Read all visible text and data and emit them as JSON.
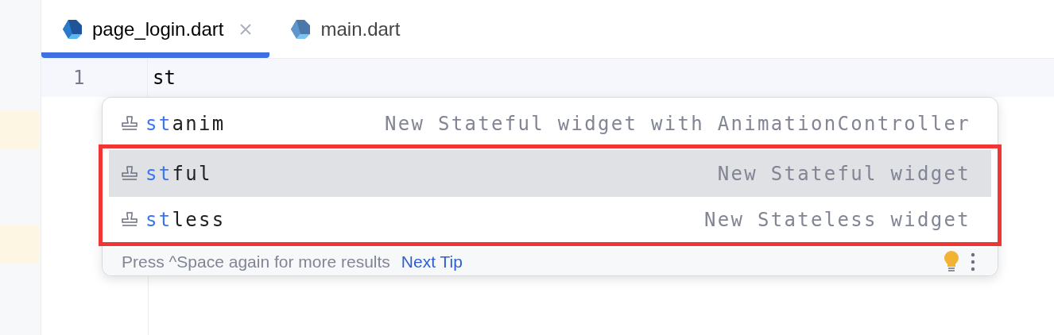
{
  "tabs": [
    {
      "label": "page_login.dart",
      "selected": true
    },
    {
      "label": "main.dart",
      "selected": false
    }
  ],
  "editor": {
    "lines": [
      {
        "number": "1",
        "text": "st"
      }
    ]
  },
  "completion": {
    "items": [
      {
        "name": "stanim",
        "description": "New Stateful widget with AnimationController",
        "selected": false,
        "outlined": false
      },
      {
        "name": "stful",
        "description": "New Stateful widget",
        "selected": true,
        "outlined": true
      },
      {
        "name": "stless",
        "description": "New Stateless widget",
        "selected": false,
        "outlined": true
      }
    ],
    "footer": {
      "hint": "Press ^Space again for more results",
      "link": "Next Tip"
    }
  }
}
